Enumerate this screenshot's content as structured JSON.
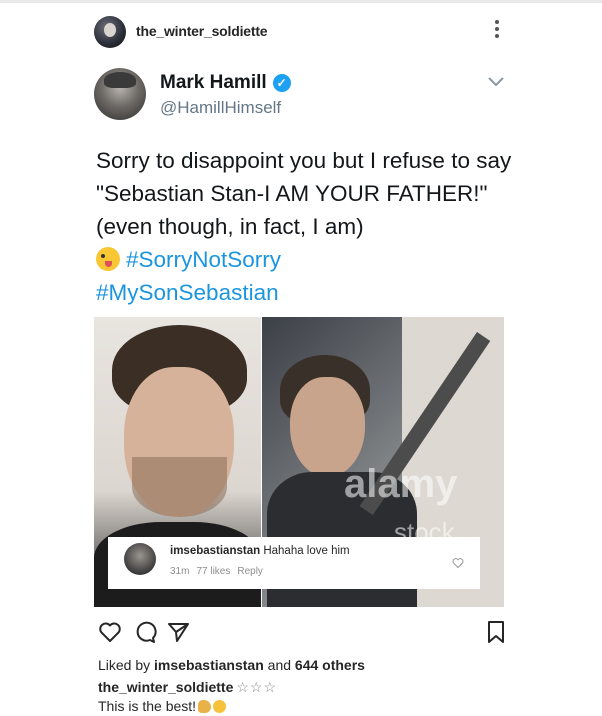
{
  "post_header": {
    "username": "the_winter_soldiette",
    "more_icon": "more-vertical-icon"
  },
  "tweet": {
    "display_name": "Mark Hamill",
    "verified_icon": "verified-check-icon",
    "handle": "@HamillHimself",
    "text_main": "Sorry to disappoint you but I refuse to say \"Sebastian Stan-I AM YOUR FATHER!\" (even though, in fact, I am)",
    "emoji_icon": "winking-tongue-face-icon",
    "hashtag_1": "#SorryNotSorry",
    "hashtag_2": "#MySonSebastian",
    "watermark_1": "alamy",
    "watermark_2": "stock photo",
    "chevron_icon": "chevron-down-icon"
  },
  "comment": {
    "username": "imsebastianstan",
    "text": "Hahaha love him",
    "time": "31m",
    "likes": "77 likes",
    "reply_label": "Reply"
  },
  "actions": {
    "like_icon": "heart-icon",
    "comment_icon": "comment-bubble-icon",
    "share_icon": "send-icon",
    "save_icon": "bookmark-icon"
  },
  "likes_line": {
    "prefix": "Liked by ",
    "user": "imsebastianstan",
    "middle": " and ",
    "others": "644 others"
  },
  "caption": {
    "username": "the_winter_soldiette",
    "stars": "☆☆☆",
    "text": "This is the best!"
  },
  "colors": {
    "hashtag": "#1b95e0",
    "verified": "#1da1f2",
    "handle": "#657786",
    "meta": "#8e8e8e"
  }
}
